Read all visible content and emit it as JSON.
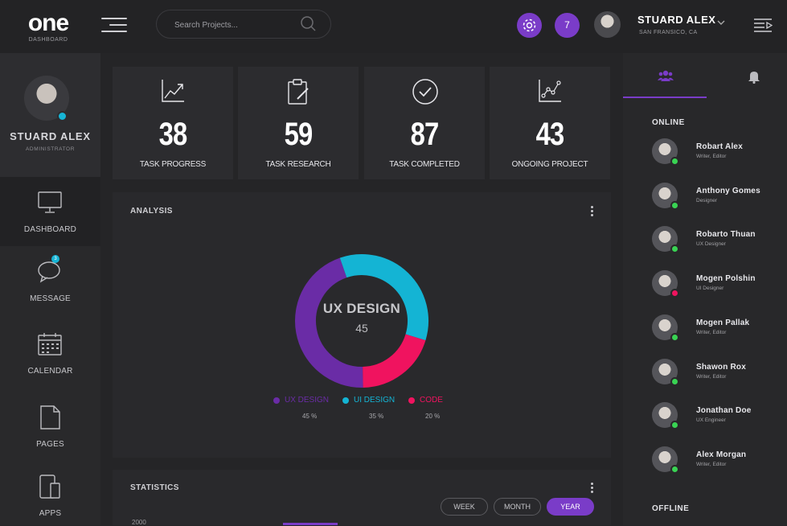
{
  "brand": {
    "logo": "one",
    "subtitle": "DASHBOARD"
  },
  "search": {
    "placeholder": "Search Projects..."
  },
  "header": {
    "notification_count": "7",
    "user_name": "STUARD ALEX",
    "user_location": "SAN FRANSICO, CA"
  },
  "profile": {
    "name": "STUARD ALEX",
    "role": "ADMINISTRATOR"
  },
  "nav": [
    {
      "label": "DASHBOARD",
      "icon": "monitor-icon"
    },
    {
      "label": "MESSAGE",
      "icon": "chat-icon",
      "badge": "3"
    },
    {
      "label": "CALENDAR",
      "icon": "calendar-icon"
    },
    {
      "label": "PAGES",
      "icon": "page-icon"
    },
    {
      "label": "APPS",
      "icon": "devices-icon"
    }
  ],
  "stats": [
    {
      "value": "38",
      "label": "TASK PROGRESS",
      "icon": "trend-icon"
    },
    {
      "value": "59",
      "label": "TASK RESEARCH",
      "icon": "clipboard-icon"
    },
    {
      "value": "87",
      "label": "TASK COMPLETED",
      "icon": "check-circle-icon"
    },
    {
      "value": "43",
      "label": "ONGOING PROJECT",
      "icon": "scatter-chart-icon"
    }
  ],
  "analysis": {
    "title": "ANALYSIS",
    "center_title": "UX DESIGN",
    "center_value": "45",
    "segments": [
      {
        "label": "UX DESIGN",
        "pct_label": "45 %",
        "value": 45,
        "color": "#6a2ca6"
      },
      {
        "label": "UI DESIGN",
        "pct_label": "35 %",
        "value": 35,
        "color": "#14b4d4"
      },
      {
        "label": "CODE",
        "pct_label": "20 %",
        "value": 20,
        "color": "#f0135f"
      }
    ]
  },
  "statistics": {
    "title": "STATISTICS",
    "filters": [
      "WEEK",
      "MONTH",
      "YEAR"
    ],
    "active_filter": "YEAR",
    "y_tick_top": "2000"
  },
  "right_panel": {
    "online_title": "ONLINE",
    "offline_title": "OFFLINE",
    "online": [
      {
        "name": "Robart Alex",
        "role": "Writer, Editor",
        "status": "#39d353"
      },
      {
        "name": "Anthony Gomes",
        "role": "Designer",
        "status": "#39d353"
      },
      {
        "name": "Robarto Thuan",
        "role": "UX Designer",
        "status": "#39d353"
      },
      {
        "name": "Mogen Polshin",
        "role": "UI Designer",
        "status": "#f0135f"
      },
      {
        "name": "Mogen Pallak",
        "role": "Writer, Editor",
        "status": "#39d353"
      },
      {
        "name": "Shawon Rox",
        "role": "Writer, Editor",
        "status": "#39d353"
      },
      {
        "name": "Jonathan Doe",
        "role": "UX Engineer",
        "status": "#39d353"
      },
      {
        "name": "Alex Morgan",
        "role": "Writer, Editor",
        "status": "#39d353"
      }
    ]
  },
  "colors": {
    "accent": "#7a3cc8",
    "online": "#39d353",
    "busy": "#f0135f",
    "cyan": "#14b4d4"
  }
}
